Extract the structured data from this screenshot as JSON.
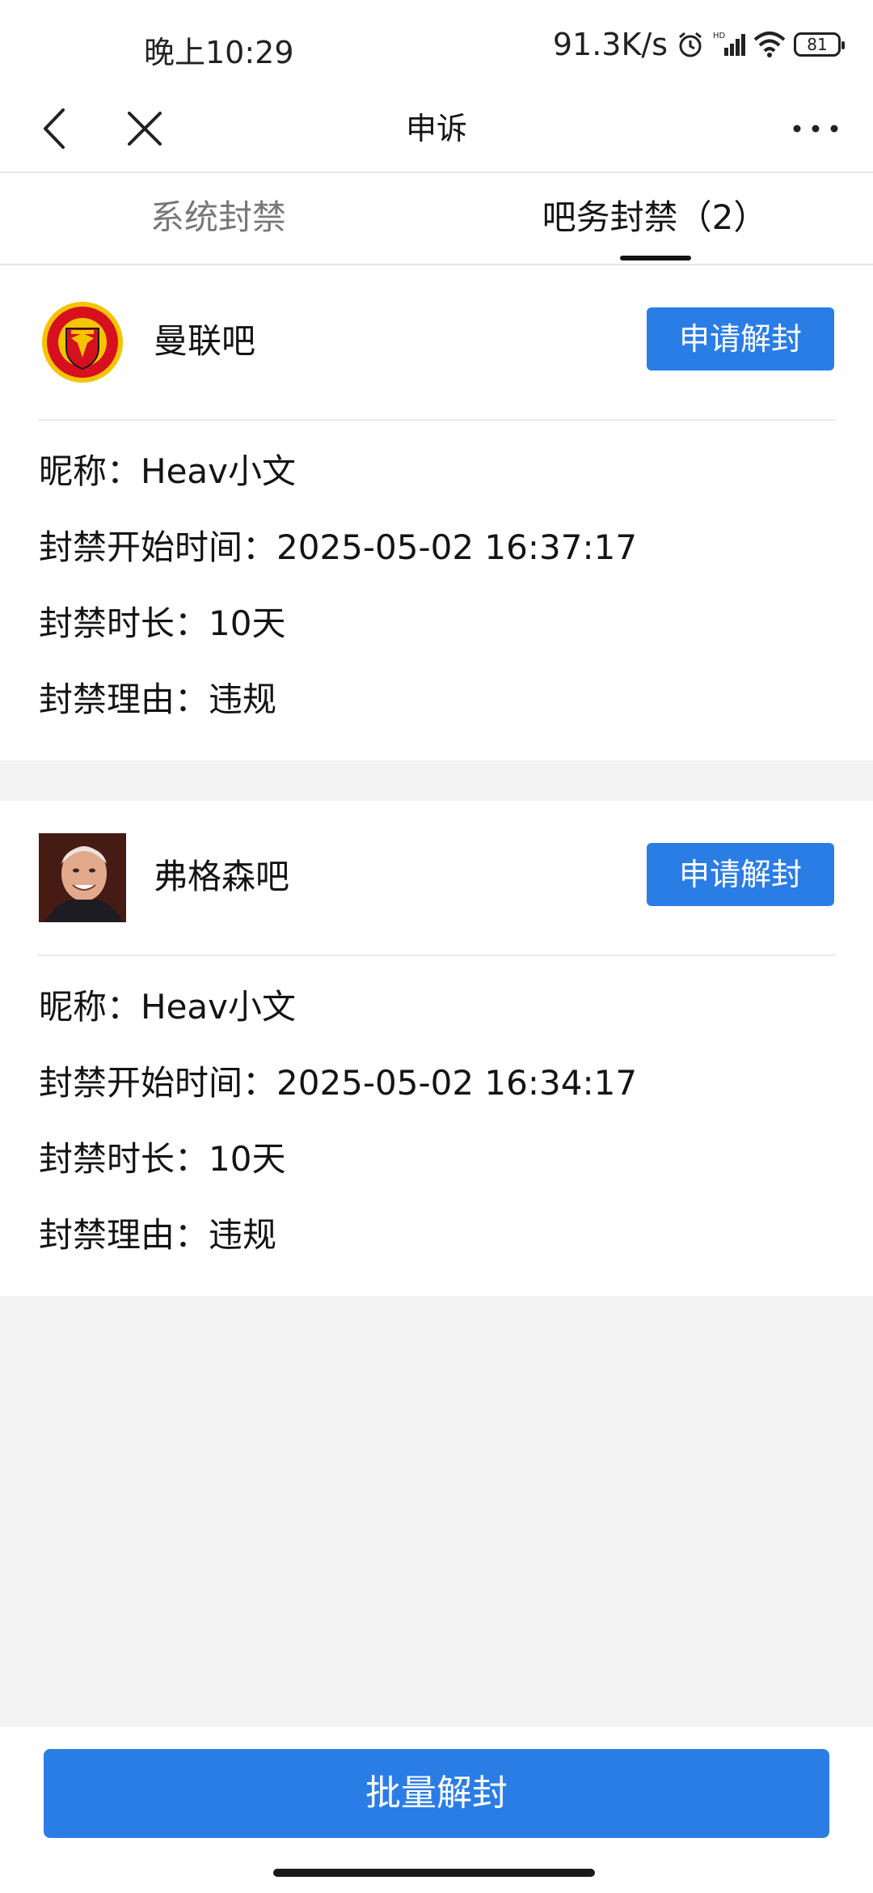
{
  "status_bar": {
    "time": "晚上10:29",
    "network_speed": "91.3K/s",
    "battery": "81"
  },
  "nav": {
    "title": "申诉"
  },
  "tabs": [
    {
      "label": "系统封禁",
      "active": false
    },
    {
      "label": "吧务封禁（2）",
      "active": true
    }
  ],
  "bans": [
    {
      "forum": "曼联吧",
      "button": "申请解封",
      "rows": [
        "昵称：Heav小文",
        "封禁开始时间：2025-05-02 16:37:17",
        "封禁时长：10天",
        "封禁理由：违规"
      ]
    },
    {
      "forum": "弗格森吧",
      "button": "申请解封",
      "rows": [
        "昵称：Heav小文",
        "封禁开始时间：2025-05-02 16:34:17",
        "封禁时长：10天",
        "封禁理由：违规"
      ]
    }
  ],
  "batch_button": "批量解封",
  "colors": {
    "accent": "#2b7de6",
    "background": "#f3f3f4"
  }
}
